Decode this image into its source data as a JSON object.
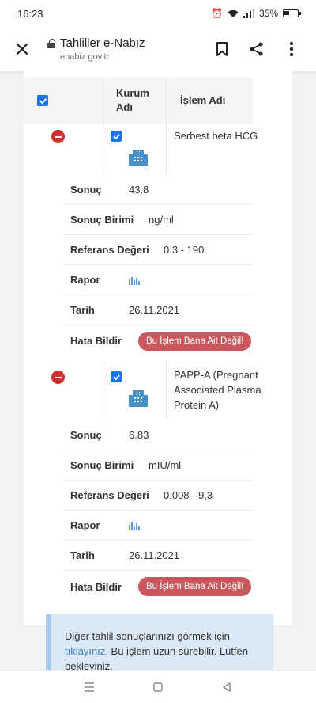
{
  "status_bar": {
    "time": "16:23",
    "battery_percent": "35%"
  },
  "browser": {
    "title": "Tahliller e-Nabız",
    "url": "enabiz.gov.tr"
  },
  "table": {
    "header": {
      "institution": "Kurum Adı",
      "procedure": "İşlem Adı"
    },
    "rows": [
      {
        "procedure_name": "Serbest beta HCG",
        "details": {
          "result_label": "Sonuç",
          "result_value": "43.8",
          "unit_label": "Sonuç Birimi",
          "unit_value": "ng/ml",
          "reference_label": "Referans Değeri",
          "reference_value": "0.3 - 190",
          "report_label": "Rapor",
          "date_label": "Tarih",
          "date_value": "26.11.2021",
          "report_error_label": "Hata Bildir",
          "report_error_button": "Bu İşlem Bana Ait Değil!"
        }
      },
      {
        "procedure_name": "PAPP-A (Pregnant Associated Plasma Protein A)",
        "details": {
          "result_label": "Sonuç",
          "result_value": "6.83",
          "unit_label": "Sonuç Birimi",
          "unit_value": "mIU/ml",
          "reference_label": "Referans Değeri",
          "reference_value": "0.008 - 9,3",
          "report_label": "Rapor",
          "date_label": "Tarih",
          "date_value": "26.11.2021",
          "report_error_label": "Hata Bildir",
          "report_error_button": "Bu İşlem Bana Ait Değil!"
        }
      }
    ]
  },
  "info": {
    "text_before_link": "Diğer tahlil sonuçlarınızı görmek için",
    "link_text": "tıklayınız.",
    "text_after_link": "Bu işlem uzun sürebilir. Lütfen bekleyiniz."
  },
  "colors": {
    "accent": "#1a73e8",
    "danger": "#d32f2f",
    "error_button": "#c9575d",
    "info_bg": "#dbe8f8",
    "link": "#3b82c4"
  }
}
